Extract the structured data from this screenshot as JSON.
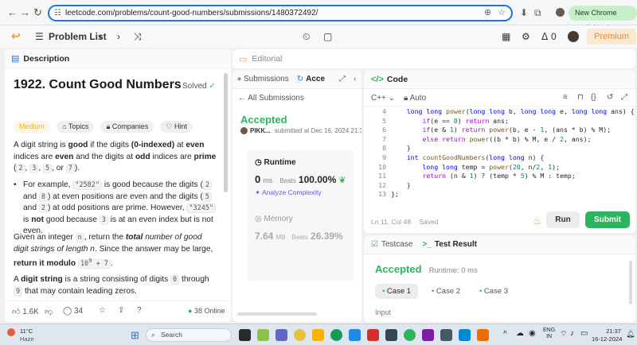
{
  "browser": {
    "url": "leetcode.com/problems/count-good-numbers/submissions/1480372492/",
    "update_label": "New Chrome available"
  },
  "nav": {
    "problem_list": "Problem List",
    "streak": "0",
    "premium": "Premium"
  },
  "description": {
    "tab": "Description",
    "title": "1922. Count Good Numbers",
    "solved": "Solved",
    "tags": [
      "Medium",
      "Topics",
      "Companies",
      "Hint"
    ],
    "p1_parts": [
      "A digit string is ",
      "good",
      " if the digits ",
      "(0-indexed)",
      " at ",
      "even",
      " indices are ",
      "even",
      " and the digits at ",
      "odd",
      " indices are ",
      "prime",
      " (",
      "2",
      ", ",
      "3",
      ", ",
      "5",
      ", or ",
      "7",
      ")."
    ],
    "bullet_parts": [
      "For example, ",
      "\"2582\"",
      " is good because the digits (",
      "2",
      " and ",
      "8",
      ") at even positions are even and the digits (",
      "5",
      " and ",
      "2",
      ") at odd positions are prime. However, ",
      "\"3245\"",
      " is ",
      "not",
      " good because ",
      "3",
      " is at an even index but is not even."
    ],
    "p2_parts": [
      "Given an integer ",
      "n",
      ", return the ",
      "total",
      " ",
      "number of good digit strings of length ",
      "n",
      ". Since the answer may be large, ",
      "return it modulo ",
      "10",
      "9",
      " + 7",
      "."
    ],
    "p3_parts": [
      "A ",
      "digit string",
      " is a string consisting of digits ",
      "0",
      " through ",
      "9",
      " that may contain leading zeros."
    ],
    "likes": "1.6K",
    "comments": "34",
    "online": "38 Online"
  },
  "editorial": {
    "tab": "Editorial"
  },
  "submissions": {
    "tab_submissions": "Submissions",
    "tab_accepted": "Acce",
    "all_submissions": "All Submissions",
    "status": "Accepted",
    "user": "PIKK...",
    "submitted_at": "submitted at Dec 16, 2024 21:37",
    "runtime_label": "Runtime",
    "runtime_value": "0",
    "runtime_unit": "ms",
    "beats_label": "Beats",
    "runtime_beats": "100.00%",
    "analyze": "Analyze Complexity",
    "memory_label": "Memory",
    "memory_value": "7.64",
    "memory_unit": "MB",
    "memory_beats": "26.39%"
  },
  "code": {
    "tab": "Code",
    "language": "C++",
    "mode": "Auto",
    "status": "Ln 11, Col 48",
    "saved": "Saved",
    "run": "Run",
    "submit": "Submit",
    "lines": [
      {
        "n": "4",
        "t": "    long long power(long long b, long long e, long long ans) {"
      },
      {
        "n": "5",
        "t": "        if(e == 0) return ans;"
      },
      {
        "n": "6",
        "t": "        if(e & 1) return power(b, e - 1, (ans * b) % M);"
      },
      {
        "n": "7",
        "t": "        else return power((b * b) % M, e / 2, ans);"
      },
      {
        "n": "8",
        "t": "    }"
      },
      {
        "n": "9",
        "t": "    int countGoodNumbers(long long n) {"
      },
      {
        "n": "10",
        "t": "        long long temp = power(20, n/2, 1);"
      },
      {
        "n": "11",
        "t": "        return (n & 1) ? (temp * 5) % M : temp;"
      },
      {
        "n": "12",
        "t": "    }"
      },
      {
        "n": "13",
        "t": "};"
      }
    ]
  },
  "testcase": {
    "tab_testcase": "Testcase",
    "tab_result": "Test Result",
    "status": "Accepted",
    "runtime": "Runtime: 0 ms",
    "cases": [
      "Case 1",
      "Case 2",
      "Case 3"
    ],
    "input_label": "Input"
  },
  "taskbar": {
    "temp": "11°C",
    "weather": "Haze",
    "search": "Search",
    "lang1": "ENG",
    "lang2": "IN",
    "time": "21:37",
    "date": "16-12-2024"
  },
  "colors": {
    "accent_green": "#2db55d",
    "accent_orange": "#ffa116",
    "chrome_blue": "#1a73e8"
  }
}
